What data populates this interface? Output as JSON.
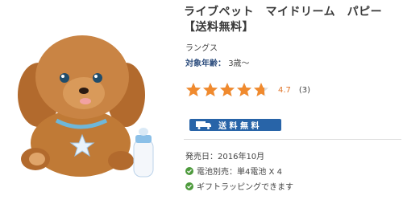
{
  "product": {
    "title_line1": "ライブペット　マイドリーム　パピー",
    "title_line2": "【送料無料】",
    "brand": "ラングス",
    "age_label": "対象年齢：",
    "age_value": "3歳〜",
    "rating": {
      "stars_filled": 4.7,
      "value": "4.7",
      "count": "(3)"
    },
    "shipping_badge": "送 料 無 料",
    "release_date": "発売日：2016年10月",
    "features": [
      "電池別売：単4電池 X 4",
      "ギフトラッピングできます"
    ]
  },
  "colors": {
    "star": "#f08a2e",
    "star_empty": "#dddddd",
    "badge": "#2864a8",
    "check": "#4d9a3c"
  },
  "icons": {
    "image": "plush-puppy-toy-with-bottle",
    "shipping": "truck-icon",
    "feature": "check-icon"
  }
}
